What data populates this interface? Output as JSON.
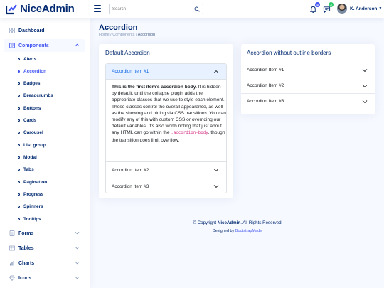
{
  "brand": {
    "name": "NiceAdmin"
  },
  "search": {
    "placeholder": "Search"
  },
  "header": {
    "notifications_count": "4",
    "messages_count": "3",
    "user_name": "K. Anderson"
  },
  "sidebar": {
    "dashboard": "Dashboard",
    "components": "Components",
    "sub_items": [
      "Alerts",
      "Accordion",
      "Badges",
      "Breadcrumbs",
      "Buttons",
      "Cards",
      "Carousel",
      "List group",
      "Modal",
      "Tabs",
      "Pagination",
      "Progress",
      "Spinners",
      "Tooltips"
    ],
    "active_sub": "Accordion",
    "forms": "Forms",
    "tables": "Tables",
    "charts": "Charts",
    "icons": "Icons"
  },
  "page": {
    "title": "Accordion",
    "breadcrumb": [
      "Home",
      "Components",
      "Accordion"
    ]
  },
  "default_accordion": {
    "title": "Default Accordion",
    "item1": "Accordion Item #1",
    "item2": "Accordion Item #2",
    "item3": "Accordion Item #3",
    "body_strong": "This is the first item's accordion body.",
    "body_text1": " It is hidden by default, until the collapse plugin adds the appropriate classes that we use to style each element. These classes control the overall appearance, as well as the showing and hiding via CSS transitions. You can modify any of this with custom CSS or overriding our default variables. It's also worth noting that just about any HTML can go within the ",
    "body_code": ".accordion-body",
    "body_text2": ", though the transition does limit overflow."
  },
  "flush_accordion": {
    "title": "Accordion without outline borders",
    "item1": "Accordion Item #1",
    "item2": "Accordion Item #2",
    "item3": "Accordion Item #3"
  },
  "footer": {
    "copyright_prefix": "© Copyright ",
    "copyright_brand": "NiceAdmin",
    "copyright_suffix": ". All Rights Reserved",
    "designed_by": "Designed by ",
    "designer": "BootstrapMade"
  },
  "colors": {
    "primary": "#4154f1",
    "navy": "#012970",
    "bg": "#f6f9ff"
  }
}
